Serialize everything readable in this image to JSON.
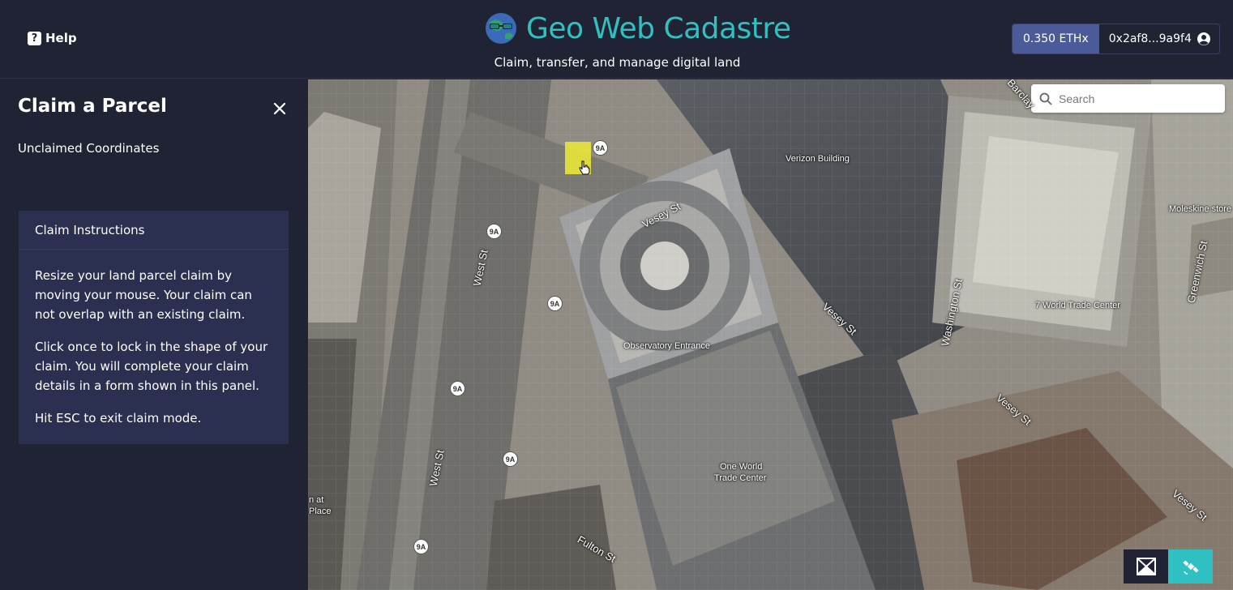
{
  "header": {
    "help_label": "Help",
    "brand_title": "Geo Web Cadastre",
    "subtitle": "Claim, transfer, and manage digital land",
    "balance": "0.350 ETHx",
    "account": "0x2af8...9a9f4",
    "accent_color": "#2fc1c1",
    "balance_bg": "#4b5a98"
  },
  "sidebar": {
    "title": "Claim a Parcel",
    "coordinates_label": "Unclaimed Coordinates",
    "card": {
      "header": "Claim Instructions",
      "paragraphs": [
        "Resize your land parcel claim by moving your mouse. Your claim can not overlap with an existing claim.",
        "Click once to lock in the shape of your claim. You will complete your claim details in a form shown in this panel.",
        "Hit ESC to exit claim mode."
      ]
    }
  },
  "map": {
    "search_placeholder": "Search",
    "pois": {
      "verizon": "Verizon Building",
      "moleskine": "Moleskine store",
      "wtc7": "7 World Trade Center",
      "observatory": "Observatory Entrance",
      "owtc_1": "One World",
      "owtc_2": "Trade Center",
      "place_1": "n at",
      "place_2": "Place"
    },
    "streets": {
      "vesey1": "Vesey St",
      "vesey2": "Vesey St",
      "vesey3": "Vesey St",
      "vesey4": "Vesey St",
      "west1": "West St",
      "west2": "West St",
      "washington": "Washington St",
      "greenwich": "Greenwich St",
      "fulton": "Fulton St",
      "barclay": "Barclay"
    },
    "route_badge": "9A",
    "icons": {
      "search": "search-icon",
      "cursor": "hand-cursor-icon",
      "map_view": "map-view-icon",
      "satellite_view": "satellite-view-icon"
    }
  }
}
